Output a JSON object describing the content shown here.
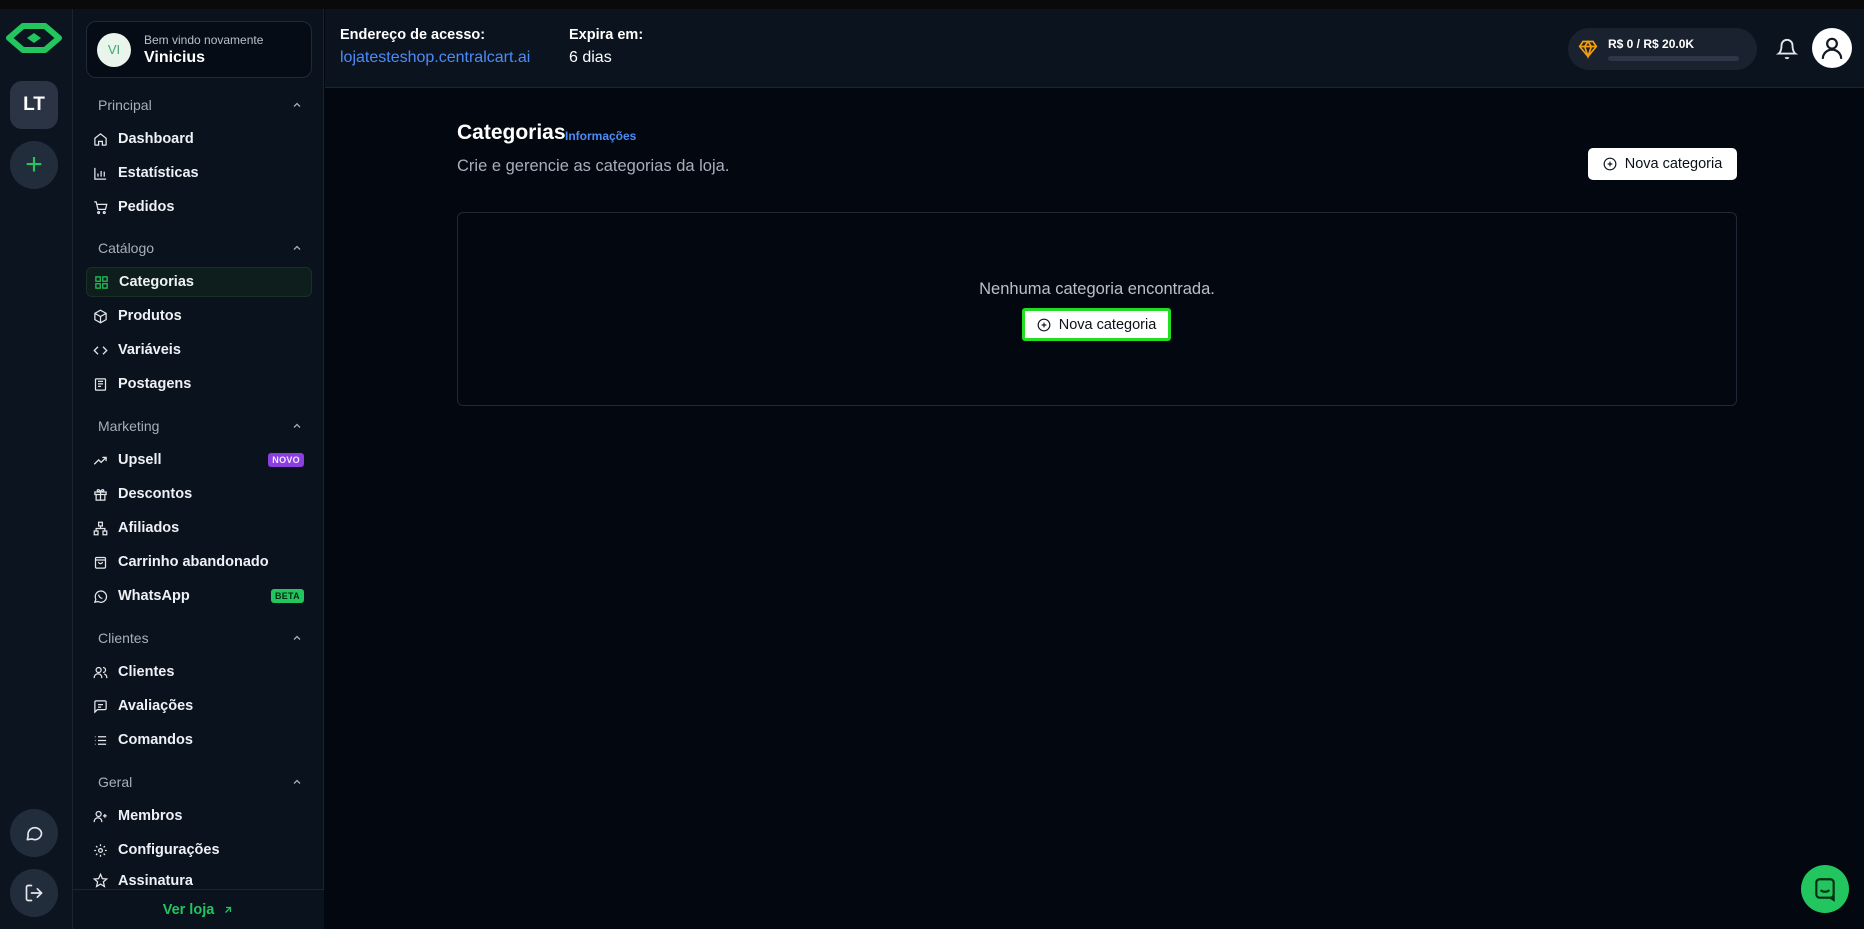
{
  "rail": {
    "store_initials": "LT",
    "add_symbol": "+",
    "icons": [
      "logo-icon",
      "chat-icon",
      "logout-icon"
    ]
  },
  "sidebar": {
    "welcome_text": "Bem vindo novamente",
    "user_name": "Vinicius",
    "user_initials": "VI",
    "sections": [
      {
        "title": "Principal",
        "items": [
          {
            "label": "Dashboard",
            "icon": "home-icon"
          },
          {
            "label": "Estatísticas",
            "icon": "bar-chart-icon"
          },
          {
            "label": "Pedidos",
            "icon": "cart-icon"
          }
        ]
      },
      {
        "title": "Catálogo",
        "items": [
          {
            "label": "Categorias",
            "icon": "grid-icon",
            "active": true
          },
          {
            "label": "Produtos",
            "icon": "box-icon"
          },
          {
            "label": "Variáveis",
            "icon": "code-icon"
          },
          {
            "label": "Postagens",
            "icon": "newspaper-icon"
          }
        ]
      },
      {
        "title": "Marketing",
        "items": [
          {
            "label": "Upsell",
            "icon": "trending-up-icon",
            "badge": "NOVO"
          },
          {
            "label": "Descontos",
            "icon": "gift-icon"
          },
          {
            "label": "Afiliados",
            "icon": "network-icon"
          },
          {
            "label": "Carrinho abandonado",
            "icon": "shopping-bag-icon"
          },
          {
            "label": "WhatsApp",
            "icon": "whatsapp-icon",
            "badge": "BETA"
          }
        ]
      },
      {
        "title": "Clientes",
        "items": [
          {
            "label": "Clientes",
            "icon": "users-icon"
          },
          {
            "label": "Avaliações",
            "icon": "message-square-icon"
          },
          {
            "label": "Comandos",
            "icon": "list-icon"
          }
        ]
      },
      {
        "title": "Geral",
        "items": [
          {
            "label": "Membros",
            "icon": "user-plus-icon"
          },
          {
            "label": "Configurações",
            "icon": "gear-icon"
          },
          {
            "label": "Assinatura",
            "icon": "star-icon"
          }
        ]
      }
    ],
    "footer_link": "Ver loja"
  },
  "topbar": {
    "address_label": "Endereço de acesso:",
    "address_value": "lojatesteshop.centralcart.ai",
    "expires_label": "Expira em:",
    "expires_value": "6 dias",
    "revenue_text": "R$ 0 / R$ 20.0K",
    "revenue_progress": 0
  },
  "main": {
    "title": "Categorias",
    "info_link": "Informações",
    "subtitle": "Crie e gerencie as categorias da loja.",
    "new_button": "Nova categoria",
    "empty_text": "Nenhuma categoria encontrada.",
    "empty_button": "Nova categoria"
  },
  "colors": {
    "accent": "#22c55e",
    "link": "#4c8cf7",
    "background": "#03070f",
    "highlight_border": "#22dd22"
  }
}
